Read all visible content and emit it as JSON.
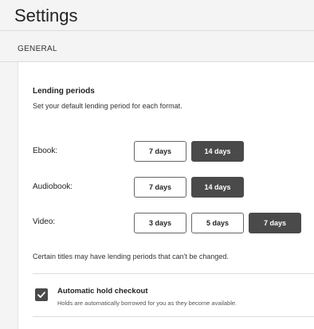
{
  "header": {
    "title": "Settings"
  },
  "section": {
    "label": "GENERAL"
  },
  "lending_periods": {
    "title": "Lending periods",
    "description": "Set your default lending period for each format.",
    "rows": [
      {
        "label": "Ebook:",
        "options": [
          {
            "label": "7 days",
            "selected": false
          },
          {
            "label": "14 days",
            "selected": true
          }
        ]
      },
      {
        "label": "Audiobook:",
        "options": [
          {
            "label": "7 days",
            "selected": false
          },
          {
            "label": "14 days",
            "selected": true
          }
        ]
      },
      {
        "label": "Video:",
        "options": [
          {
            "label": "3 days",
            "selected": false
          },
          {
            "label": "5 days",
            "selected": false
          },
          {
            "label": "7 days",
            "selected": true
          }
        ]
      }
    ],
    "note": "Certain titles may have lending periods that can't be changed."
  },
  "auto_hold": {
    "checked": true,
    "title": "Automatic hold checkout",
    "description": "Holds are automatically borrowed for you as they become available.",
    "icon": "checkmark-icon"
  },
  "colors": {
    "selected": "#4a4a4a",
    "background": "#f4f4f4",
    "card": "#ffffff"
  }
}
